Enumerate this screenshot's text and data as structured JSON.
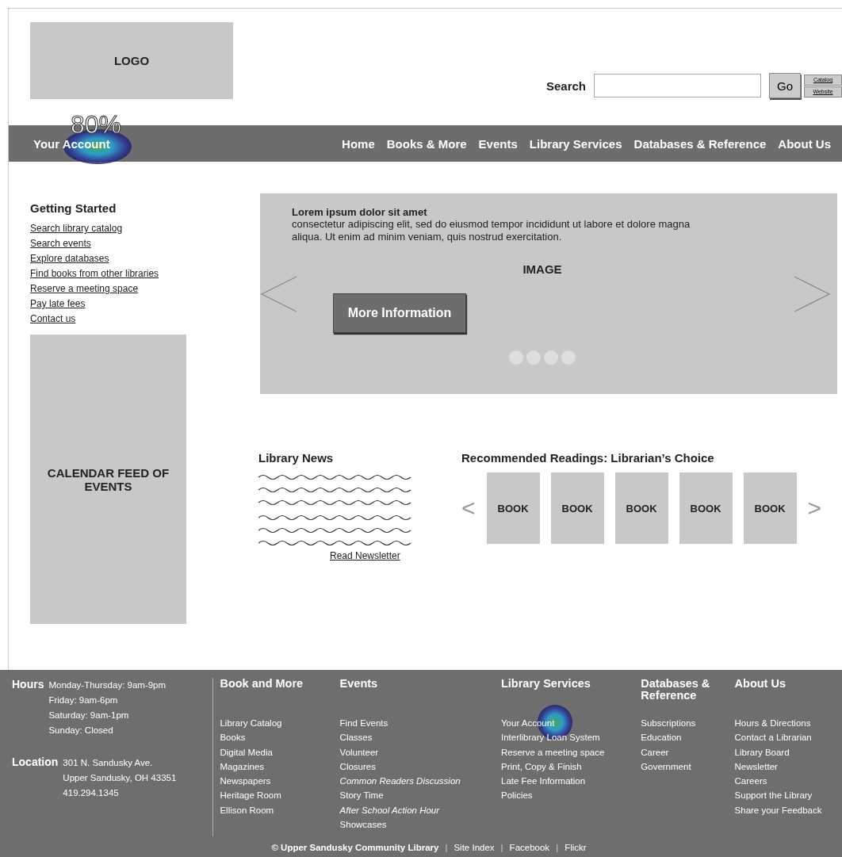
{
  "header": {
    "logo": "LOGO",
    "search": {
      "label": "Search",
      "button": "Go",
      "scopes": [
        {
          "label": "Catalog"
        },
        {
          "label": "Website"
        }
      ]
    }
  },
  "nav": [
    {
      "label": "Your Account",
      "kind": "account",
      "heat_label": "80%"
    },
    {
      "label": "Home",
      "kind": "menu"
    },
    {
      "label": "Books & More",
      "kind": "menu"
    },
    {
      "label": "Events",
      "kind": "menu"
    },
    {
      "label": "Library Services",
      "kind": "menu"
    },
    {
      "label": "Databases & Reference",
      "kind": "menu"
    },
    {
      "label": "About Us",
      "kind": "menu"
    }
  ],
  "sidebar": {
    "title": "Getting Started",
    "links": [
      "Search library catalog",
      "Search events",
      "Explore databases",
      "Find books from other libraries",
      "Reserve a meeting space",
      "Pay late fees",
      "Contact us"
    ],
    "calendar": "CALENDAR FEED OF EVENTS"
  },
  "carousel": {
    "title": "Lorem ipsum dolor sit amet",
    "text": "consectetur adipiscing elit, sed do eiusmod tempor incididunt ut labore et dolore magna aliqua. Ut enim ad minim veniam, quis nostrud exercitation.",
    "image_label": "IMAGE",
    "button": "More Information",
    "dots": [
      {
        "selected": false
      },
      {
        "selected": false
      },
      {
        "selected": false
      },
      {
        "selected": false
      }
    ]
  },
  "news": {
    "title": "Library News",
    "link": "Read Newsletter"
  },
  "recommended": {
    "title": "Recommended Readings: Librarian’s Choice",
    "prev": "<",
    "next": ">",
    "books": [
      "BOOK",
      "BOOK",
      "BOOK",
      "BOOK",
      "BOOK"
    ]
  },
  "footer": {
    "hours_label": "Hours",
    "hours": [
      "Monday-Thursday: 9am-9pm",
      "Friday: 9am-6pm",
      "Saturday: 9am-1pm",
      "Sunday: Closed"
    ],
    "location_label": "Location",
    "location": [
      "301 N. Sandusky Ave.",
      "Upper Sandusky, OH 43351",
      "419.294.1345"
    ],
    "columns": [
      {
        "title": "Book and More",
        "links": [
          {
            "label": "Library Catalog"
          },
          {
            "label": "Books"
          },
          {
            "label": "Digital Media"
          },
          {
            "label": "Magazines"
          },
          {
            "label": "Newspapers"
          },
          {
            "label": "Heritage Room"
          },
          {
            "label": "Ellison Room"
          }
        ]
      },
      {
        "title": "Events",
        "links": [
          {
            "label": "Find Events"
          },
          {
            "label": "Classes"
          },
          {
            "label": "Volunteer"
          },
          {
            "label": "Closures"
          },
          {
            "label": "Common Readers Discussion",
            "italic": true
          },
          {
            "label": "Story Time"
          },
          {
            "label": "After School Action Hour",
            "italic": true
          },
          {
            "label": "Showcases"
          }
        ]
      },
      {
        "title": "Library Services",
        "links": [
          {
            "label": "Your Account",
            "hot": true
          },
          {
            "label": "Interlibrary Loan System"
          },
          {
            "label": "Reserve a meeting space"
          },
          {
            "label": "Print, Copy & Finish"
          },
          {
            "label": "Late Fee Information"
          },
          {
            "label": "Policies"
          }
        ]
      },
      {
        "title": "Databases & Reference",
        "links": [
          {
            "label": "Subscriptions"
          },
          {
            "label": "Education"
          },
          {
            "label": "Career"
          },
          {
            "label": "Government"
          }
        ]
      },
      {
        "title": "About Us",
        "links": [
          {
            "label": "Hours & Directions"
          },
          {
            "label": "Contact a Librarian"
          },
          {
            "label": "Library Board"
          },
          {
            "label": "Newsletter"
          },
          {
            "label": "Careers"
          },
          {
            "label": "Support the Library"
          },
          {
            "label": "Share your Feedback"
          }
        ]
      }
    ],
    "bottom": {
      "copyright": "© Upper Sandusky Community Library",
      "separator": "|",
      "links": [
        "Site Index",
        "Facebook",
        "Flickr"
      ]
    }
  }
}
